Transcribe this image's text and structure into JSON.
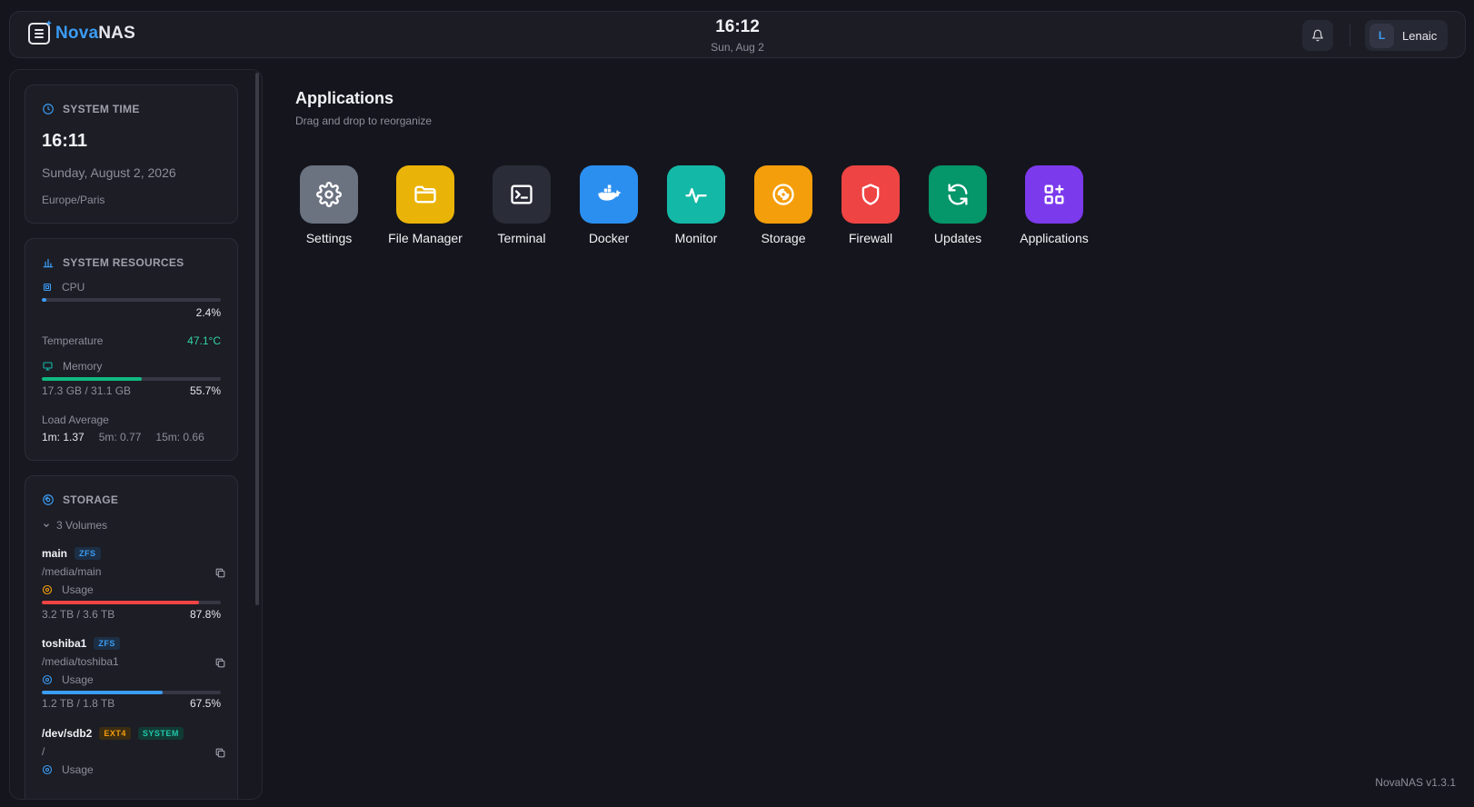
{
  "header": {
    "brand_part1": "Nova",
    "brand_part2": "NAS",
    "time": "16:12",
    "date": "Sun, Aug 2",
    "user_initial": "L",
    "user_name": "Lenaic"
  },
  "sidebar": {
    "system_time": {
      "title": "SYSTEM TIME",
      "time": "16:11",
      "date": "Sunday, August 2, 2026",
      "timezone": "Europe/Paris"
    },
    "system_resources": {
      "title": "SYSTEM RESOURCES",
      "cpu_label": "CPU",
      "cpu_value": "2.4%",
      "cpu_fraction": 0.024,
      "temperature_label": "Temperature",
      "temperature_value": "47.1°C",
      "memory_label": "Memory",
      "memory_used": "17.3 GB / 31.1 GB",
      "memory_value": "55.7%",
      "memory_fraction": 0.557,
      "load_label": "Load Average",
      "load_1m": "1m: 1.37",
      "load_5m": "5m: 0.77",
      "load_15m": "15m: 0.66"
    },
    "storage": {
      "title": "STORAGE",
      "volumes_toggle": "3 Volumes",
      "volumes": [
        {
          "name": "main",
          "fs": "ZFS",
          "path": "/media/main",
          "usage_label": "Usage",
          "used": "3.2 TB / 3.6 TB",
          "percent": "87.8%",
          "fraction": 0.878,
          "color": "#ef4444"
        },
        {
          "name": "toshiba1",
          "fs": "ZFS",
          "path": "/media/toshiba1",
          "usage_label": "Usage",
          "used": "1.2 TB / 1.8 TB",
          "percent": "67.5%",
          "fraction": 0.675,
          "color": "#3b9cf4"
        },
        {
          "name": "/dev/sdb2",
          "fs": "EXT4",
          "tag": "SYSTEM",
          "path": "/",
          "usage_label": "Usage"
        }
      ]
    }
  },
  "main": {
    "title": "Applications",
    "subtitle": "Drag and drop to reorganize",
    "apps": [
      {
        "label": "Settings",
        "icon": "gear-icon",
        "color": "#6b7280"
      },
      {
        "label": "File Manager",
        "icon": "folder-icon",
        "color": "#eab308"
      },
      {
        "label": "Terminal",
        "icon": "terminal-icon",
        "color": "#2a2c37"
      },
      {
        "label": "Docker",
        "icon": "docker-icon",
        "color": "#2b8ff0"
      },
      {
        "label": "Monitor",
        "icon": "activity-icon",
        "color": "#14b8a6"
      },
      {
        "label": "Storage",
        "icon": "disc-icon",
        "color": "#f59e0b"
      },
      {
        "label": "Firewall",
        "icon": "shield-icon",
        "color": "#ef4444"
      },
      {
        "label": "Updates",
        "icon": "refresh-icon",
        "color": "#059669"
      },
      {
        "label": "Applications",
        "icon": "apps-icon",
        "color": "#7c3aed"
      }
    ]
  },
  "footer": {
    "version": "NovaNAS v1.3.1"
  }
}
